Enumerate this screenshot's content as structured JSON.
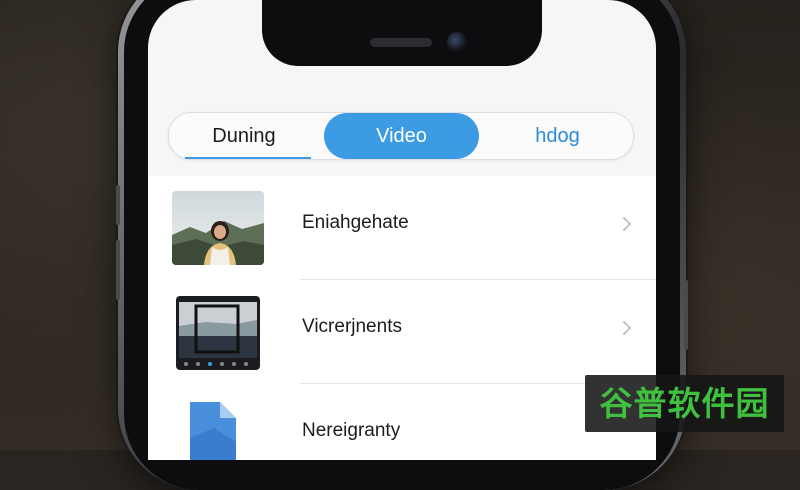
{
  "tabs": [
    {
      "label": "Duning",
      "selected": false
    },
    {
      "label": "Video",
      "selected": true
    },
    {
      "label": "hdog",
      "selected": false
    }
  ],
  "list": {
    "items": [
      {
        "title": "Eniahgehate",
        "thumbnail": "portrait-photo"
      },
      {
        "title": "Vicrerjnents",
        "thumbnail": "photo-editor-screenshot"
      },
      {
        "title": "Nereigranty",
        "thumbnail": "document-file-icon"
      }
    ]
  },
  "watermark": {
    "text": "谷普软件园"
  },
  "colors": {
    "accent": "#3d9be3",
    "background": "#f6f6f7",
    "watermark": "#3fc03f"
  }
}
